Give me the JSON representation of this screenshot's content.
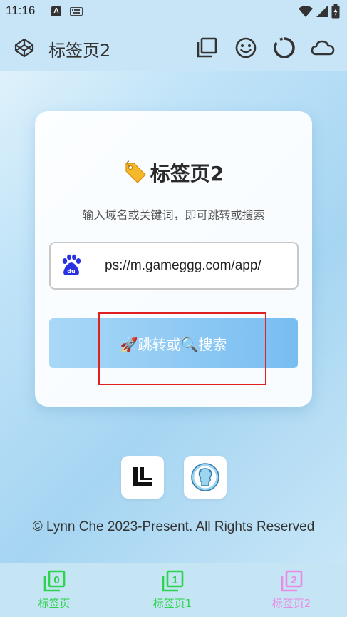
{
  "status_bar": {
    "time": "11:16",
    "notification_letter": "A"
  },
  "app_bar": {
    "title": "标签页2"
  },
  "card": {
    "title": "标签页2",
    "subtitle": "输入域名或关键词，即可跳转或搜索",
    "url_value": "ps://m.gameggg.com/app/",
    "go_label": "🚀跳转或🔍搜索"
  },
  "footer": {
    "copyright": "© Lynn Che 2023-Present. All Rights Reserved"
  },
  "bottom_nav": {
    "items": [
      {
        "label": "标签页",
        "digit": "0",
        "color": "#2bd44a"
      },
      {
        "label": "标签页1",
        "digit": "1",
        "color": "#2bd44a"
      },
      {
        "label": "标签页2",
        "digit": "2",
        "color": "#e88ae6"
      }
    ]
  },
  "colors": {
    "highlight": "#e02020",
    "button_start": "#a9d8f7",
    "button_end": "#78bdf1"
  }
}
